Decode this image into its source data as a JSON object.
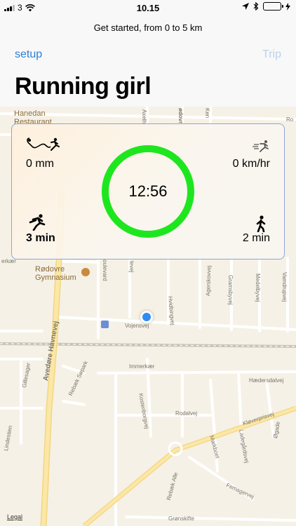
{
  "status_bar": {
    "carrier": "3",
    "time": "10.15"
  },
  "nav": {
    "subtitle": "Get started, from 0 to 5 km",
    "left_button": "setup",
    "right_button": "Trip",
    "title": "Running girl"
  },
  "card": {
    "distance": "0 mm",
    "speed": "0 km/hr",
    "run_time": "3 min",
    "walk_time": "2 min",
    "timer": "12:56",
    "ring_color": "#1ee61e"
  },
  "map": {
    "labels": {
      "hanedan": "Hanedan\nRestaurant",
      "rodovre": "Rødovre\nGymnasium",
      "vojensvej": "Vojensvej",
      "avedore": "Avedøre Havnevej",
      "immerkaer": "Immerkær",
      "haedersdalvej": "Hædersdalvej",
      "rodalvej": "Rodalvej",
      "kloverprisvej": "Kløverprisvej",
      "femagervej": "Femagervej",
      "gronskifte": "Grønskifte",
      "rebaek_sopark": "Rebæk Søpark",
      "rebaek_alle": "Rebæk Alle",
      "gillesager": "Gillesager",
      "lindestien": "Lindestien",
      "kostenborgvej": "Kostenborgvej",
      "hvidbingvej": "Hvidbingvej",
      "agerskovvej": "Agerskovvej",
      "gramsbyvej": "Gramsbyvej",
      "medelbyvej": "Medelbyvej",
      "vamdrupvej": "Vamdrupvej",
      "markboet": "Markboet",
      "ladegardsvej": "Ladegårdsvej",
      "ogade": "Øgade",
      "axelh": "Axelh",
      "odovr": "ødovr",
      "ken": "Ken",
      "ro": "Ro",
      "erkaer": "erkær",
      "oulevard": "oulevard",
      "levej": "levej"
    },
    "legal": "Legal"
  },
  "colors": {
    "accent": "#2b7fd8",
    "disabled": "#b9d2ee",
    "location": "#2f8cf4"
  }
}
